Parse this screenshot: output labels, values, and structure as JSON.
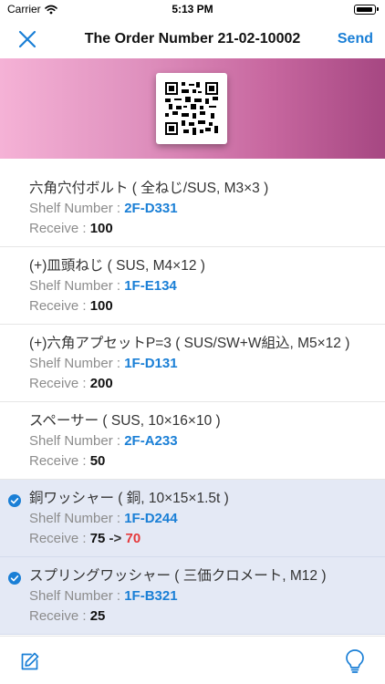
{
  "status_bar": {
    "carrier": "Carrier",
    "time": "5:13 PM",
    "battery_level": 0.95
  },
  "nav": {
    "title": "The Order Number 21-02-10002",
    "send_label": "Send",
    "close_icon": "close-icon"
  },
  "accent_color": "#1a7fd6",
  "items": [
    {
      "name": "六角穴付ボルト ( 全ねじ/SUS, M3×3 )",
      "shelf_label": "Shelf Number : ",
      "shelf": "2F-D331",
      "receive_label": "Receive : ",
      "receive": "100",
      "checked": false
    },
    {
      "name": "(+)皿頭ねじ ( SUS, M4×12 )",
      "shelf_label": "Shelf Number : ",
      "shelf": "1F-E134",
      "receive_label": "Receive : ",
      "receive": "100",
      "checked": false
    },
    {
      "name": "(+)六角アプセットP=3 ( SUS/SW+W組込, M5×12 )",
      "shelf_label": "Shelf Number : ",
      "shelf": "1F-D131",
      "receive_label": "Receive : ",
      "receive": "200",
      "checked": false
    },
    {
      "name": "スペーサー ( SUS, 10×16×10 )",
      "shelf_label": "Shelf Number : ",
      "shelf": "2F-A233",
      "receive_label": "Receive : ",
      "receive": "50",
      "checked": false
    },
    {
      "name": "銅ワッシャー ( 銅, 10×15×1.5t )",
      "shelf_label": "Shelf Number : ",
      "shelf": "1F-D244",
      "receive_label": "Receive : ",
      "receive": "75",
      "receive_arrow": " -> ",
      "receive_new": "70",
      "checked": true
    },
    {
      "name": "スプリングワッシャー ( 三価クロメート, M12 )",
      "shelf_label": "Shelf Number : ",
      "shelf": "1F-B321",
      "receive_label": "Receive : ",
      "receive": "25",
      "checked": true
    }
  ],
  "bottom_bar": {
    "left_icon": "compose-icon",
    "right_icon": "lightbulb-icon"
  }
}
